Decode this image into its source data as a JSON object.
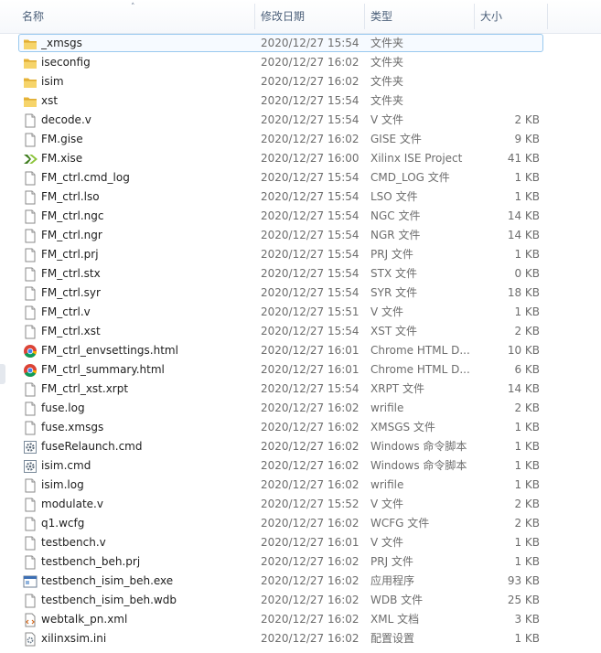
{
  "columns": {
    "name": "名称",
    "date": "修改日期",
    "type": "类型",
    "size": "大小"
  },
  "files": [
    {
      "name": "_xmsgs",
      "date": "2020/12/27 15:54",
      "type": "文件夹",
      "size": "",
      "icon": "folder-icon"
    },
    {
      "name": "iseconfig",
      "date": "2020/12/27 16:02",
      "type": "文件夹",
      "size": "",
      "icon": "folder-icon"
    },
    {
      "name": "isim",
      "date": "2020/12/27 16:02",
      "type": "文件夹",
      "size": "",
      "icon": "folder-icon"
    },
    {
      "name": "xst",
      "date": "2020/12/27 15:54",
      "type": "文件夹",
      "size": "",
      "icon": "folder-icon"
    },
    {
      "name": "decode.v",
      "date": "2020/12/27 15:54",
      "type": "V 文件",
      "size": "2 KB",
      "icon": "file-icon"
    },
    {
      "name": "FM.gise",
      "date": "2020/12/27 16:02",
      "type": "GISE 文件",
      "size": "9 KB",
      "icon": "file-icon"
    },
    {
      "name": "FM.xise",
      "date": "2020/12/27 16:00",
      "type": "Xilinx ISE Project",
      "size": "41 KB",
      "icon": "xilinx-icon"
    },
    {
      "name": "FM_ctrl.cmd_log",
      "date": "2020/12/27 15:54",
      "type": "CMD_LOG 文件",
      "size": "1 KB",
      "icon": "file-icon"
    },
    {
      "name": "FM_ctrl.lso",
      "date": "2020/12/27 15:54",
      "type": "LSO 文件",
      "size": "1 KB",
      "icon": "file-icon"
    },
    {
      "name": "FM_ctrl.ngc",
      "date": "2020/12/27 15:54",
      "type": "NGC 文件",
      "size": "14 KB",
      "icon": "file-icon"
    },
    {
      "name": "FM_ctrl.ngr",
      "date": "2020/12/27 15:54",
      "type": "NGR 文件",
      "size": "14 KB",
      "icon": "file-icon"
    },
    {
      "name": "FM_ctrl.prj",
      "date": "2020/12/27 15:54",
      "type": "PRJ 文件",
      "size": "1 KB",
      "icon": "file-icon"
    },
    {
      "name": "FM_ctrl.stx",
      "date": "2020/12/27 15:54",
      "type": "STX 文件",
      "size": "0 KB",
      "icon": "file-icon"
    },
    {
      "name": "FM_ctrl.syr",
      "date": "2020/12/27 15:54",
      "type": "SYR 文件",
      "size": "18 KB",
      "icon": "file-icon"
    },
    {
      "name": "FM_ctrl.v",
      "date": "2020/12/27 15:51",
      "type": "V 文件",
      "size": "1 KB",
      "icon": "file-icon"
    },
    {
      "name": "FM_ctrl.xst",
      "date": "2020/12/27 15:54",
      "type": "XST 文件",
      "size": "2 KB",
      "icon": "file-icon"
    },
    {
      "name": "FM_ctrl_envsettings.html",
      "date": "2020/12/27 16:01",
      "type": "Chrome HTML D...",
      "size": "10 KB",
      "icon": "chrome-icon"
    },
    {
      "name": "FM_ctrl_summary.html",
      "date": "2020/12/27 16:01",
      "type": "Chrome HTML D...",
      "size": "6 KB",
      "icon": "chrome-icon"
    },
    {
      "name": "FM_ctrl_xst.xrpt",
      "date": "2020/12/27 15:54",
      "type": "XRPT 文件",
      "size": "14 KB",
      "icon": "file-icon"
    },
    {
      "name": "fuse.log",
      "date": "2020/12/27 16:02",
      "type": "wrifile",
      "size": "2 KB",
      "icon": "file-icon"
    },
    {
      "name": "fuse.xmsgs",
      "date": "2020/12/27 16:02",
      "type": "XMSGS 文件",
      "size": "1 KB",
      "icon": "file-icon"
    },
    {
      "name": "fuseRelaunch.cmd",
      "date": "2020/12/27 16:02",
      "type": "Windows 命令脚本",
      "size": "1 KB",
      "icon": "gear-icon"
    },
    {
      "name": "isim.cmd",
      "date": "2020/12/27 16:02",
      "type": "Windows 命令脚本",
      "size": "1 KB",
      "icon": "gear-icon"
    },
    {
      "name": "isim.log",
      "date": "2020/12/27 16:02",
      "type": "wrifile",
      "size": "1 KB",
      "icon": "file-icon"
    },
    {
      "name": "modulate.v",
      "date": "2020/12/27 15:52",
      "type": "V 文件",
      "size": "2 KB",
      "icon": "file-icon"
    },
    {
      "name": "q1.wcfg",
      "date": "2020/12/27 16:02",
      "type": "WCFG 文件",
      "size": "2 KB",
      "icon": "file-icon"
    },
    {
      "name": "testbench.v",
      "date": "2020/12/27 16:01",
      "type": "V 文件",
      "size": "1 KB",
      "icon": "file-icon"
    },
    {
      "name": "testbench_beh.prj",
      "date": "2020/12/27 16:02",
      "type": "PRJ 文件",
      "size": "1 KB",
      "icon": "file-icon"
    },
    {
      "name": "testbench_isim_beh.exe",
      "date": "2020/12/27 16:02",
      "type": "应用程序",
      "size": "93 KB",
      "icon": "exe-icon"
    },
    {
      "name": "testbench_isim_beh.wdb",
      "date": "2020/12/27 16:02",
      "type": "WDB 文件",
      "size": "25 KB",
      "icon": "file-icon"
    },
    {
      "name": "webtalk_pn.xml",
      "date": "2020/12/27 16:02",
      "type": "XML 文档",
      "size": "3 KB",
      "icon": "xml-icon"
    },
    {
      "name": "xilinxsim.ini",
      "date": "2020/12/27 16:02",
      "type": "配置设置",
      "size": "1 KB",
      "icon": "ini-icon"
    }
  ]
}
